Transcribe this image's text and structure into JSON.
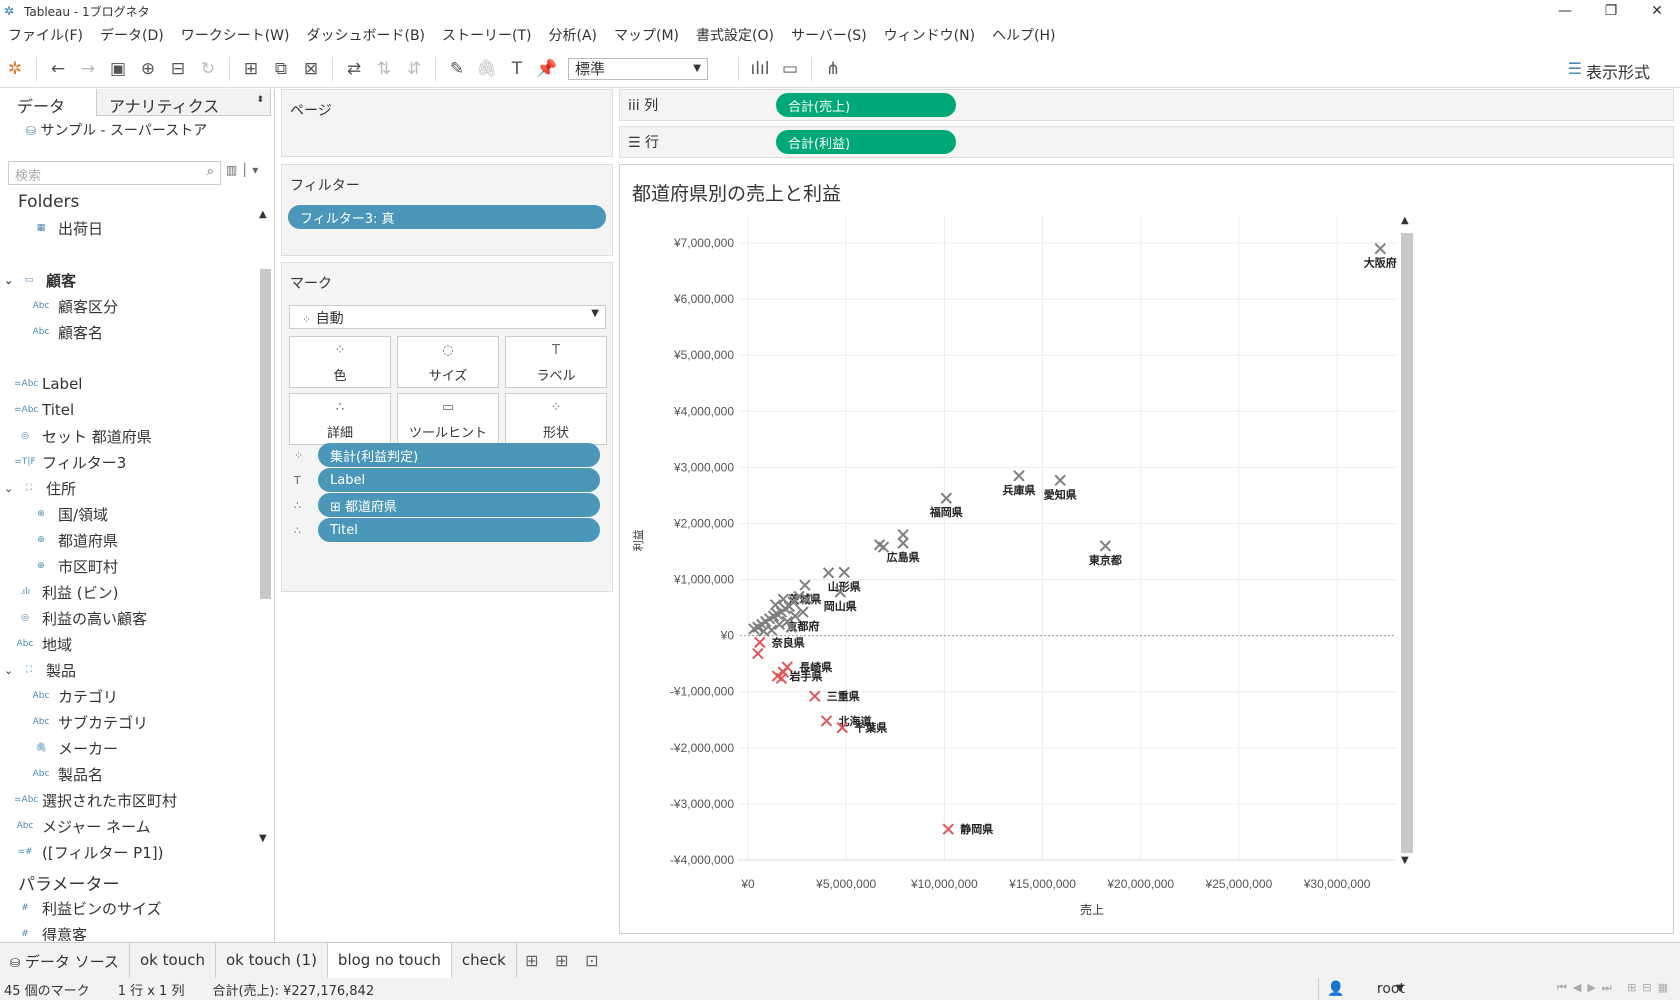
{
  "window": {
    "title": "Tableau - 1ブログネタ"
  },
  "menu": [
    "ファイル(F)",
    "データ(D)",
    "ワークシート(W)",
    "ダッシュボード(B)",
    "ストーリー(T)",
    "分析(A)",
    "マップ(M)",
    "書式設定(O)",
    "サーバー(S)",
    "ウィンドウ(N)",
    "ヘルプ(H)"
  ],
  "toolbar": {
    "fit": "標準",
    "show_me": "表示形式"
  },
  "data_pane": {
    "tab_data": "データ",
    "tab_analytics": "アナリティクス",
    "source": "サンプル - スーパーストア",
    "search_placeholder": "検索",
    "folders_label": "Folders",
    "fields": [
      {
        "icon": "calendar-icon",
        "label": "出荷日",
        "indent": 2,
        "glyph": "▦"
      },
      {
        "icon": "spacer",
        "label": "",
        "indent": 0,
        "glyph": ""
      },
      {
        "icon": "folder-icon",
        "label": "顧客",
        "indent": 1,
        "glyph": "▭",
        "hdr": true,
        "chev": "⌄"
      },
      {
        "icon": "abc-icon",
        "label": "顧客区分",
        "indent": 2,
        "glyph": "Abc"
      },
      {
        "icon": "abc-icon",
        "label": "顧客名",
        "indent": 2,
        "glyph": "Abc"
      },
      {
        "icon": "spacer",
        "label": "",
        "indent": 0,
        "glyph": ""
      },
      {
        "icon": "calc-abc-icon",
        "label": "Label",
        "indent": 1,
        "glyph": "=Abc"
      },
      {
        "icon": "calc-abc-icon",
        "label": "Titel",
        "indent": 1,
        "glyph": "=Abc"
      },
      {
        "icon": "set-icon",
        "label": "セット 都道府県",
        "indent": 1,
        "glyph": "◎"
      },
      {
        "icon": "calc-bool-icon",
        "label": "フィルター3",
        "indent": 1,
        "glyph": "=T|F"
      },
      {
        "icon": "hierarchy-icon",
        "label": "住所",
        "indent": 1,
        "glyph": "⛶",
        "chev": "⌄"
      },
      {
        "icon": "globe-icon",
        "label": "国/領域",
        "indent": 2,
        "glyph": "⊕"
      },
      {
        "icon": "globe-icon",
        "label": "都道府県",
        "indent": 2,
        "glyph": "⊕"
      },
      {
        "icon": "globe-icon",
        "label": "市区町村",
        "indent": 2,
        "glyph": "⊕"
      },
      {
        "icon": "bin-icon",
        "label": "利益 (ビン)",
        "indent": 1,
        "glyph": ".ılı"
      },
      {
        "icon": "set-icon",
        "label": "利益の高い顧客",
        "indent": 1,
        "glyph": "◎"
      },
      {
        "icon": "abc-icon",
        "label": "地域",
        "indent": 1,
        "glyph": "Abc"
      },
      {
        "icon": "hierarchy-icon",
        "label": "製品",
        "indent": 1,
        "glyph": "⛶",
        "chev": "⌄"
      },
      {
        "icon": "abc-icon",
        "label": "カテゴリ",
        "indent": 2,
        "glyph": "Abc"
      },
      {
        "icon": "abc-icon",
        "label": "サブカテゴリ",
        "indent": 2,
        "glyph": "Abc"
      },
      {
        "icon": "paperclip-icon",
        "label": "メーカー",
        "indent": 2,
        "glyph": "🖇"
      },
      {
        "icon": "abc-icon",
        "label": "製品名",
        "indent": 2,
        "glyph": "Abc"
      },
      {
        "icon": "calc-abc-icon",
        "label": "選択された市区町村",
        "indent": 1,
        "glyph": "=Abc"
      },
      {
        "icon": "abc-icon",
        "label": "メジャー ネーム",
        "indent": 1,
        "glyph": "Abc"
      },
      {
        "icon": "calc-number-icon",
        "label": "([フィルター P1])",
        "indent": 1,
        "glyph": "=#"
      }
    ],
    "parameters_label": "パラメーター",
    "parameters": [
      {
        "label": "利益ビンのサイズ",
        "glyph": "#"
      },
      {
        "label": "得意客",
        "glyph": "#"
      }
    ]
  },
  "shelves": {
    "pages": "ページ",
    "filters": "フィルター",
    "filter_pill": "フィルター3: 真",
    "marks": "マーク",
    "mark_type": "自動",
    "mark_buttons": [
      {
        "label": "色",
        "glyph": "⁘",
        "name": "color-button"
      },
      {
        "label": "サイズ",
        "glyph": "◌",
        "name": "size-button"
      },
      {
        "label": "ラベル",
        "glyph": "T",
        "name": "label-button"
      },
      {
        "label": "詳細",
        "glyph": "∴",
        "name": "detail-button"
      },
      {
        "label": "ツールヒント",
        "glyph": "▭",
        "name": "tooltip-button"
      },
      {
        "label": "形状",
        "glyph": "⁘",
        "name": "shape-button"
      }
    ],
    "mark_fields": [
      {
        "label": "集計(利益判定)",
        "glyph": "⁘"
      },
      {
        "label": "Label",
        "glyph": "T"
      },
      {
        "label": "⊞ 都道府県",
        "glyph": "∴"
      },
      {
        "label": "Titel",
        "glyph": "∴"
      }
    ],
    "columns_label": "iii 列",
    "columns_pill": "合計(売上)",
    "rows_label": "☰ 行",
    "rows_pill": "合計(利益)"
  },
  "chart_title": "都道府県別の売上と利益",
  "chart_data": {
    "type": "scatter",
    "title": "都道府県別の売上と利益",
    "xlabel": "売上",
    "ylabel": "利益",
    "xlim": [
      0,
      33000000
    ],
    "ylim": [
      -4000000,
      7500000
    ],
    "xticks": [
      0,
      5000000,
      10000000,
      15000000,
      20000000,
      25000000,
      30000000
    ],
    "xtick_labels": [
      "¥0",
      "¥5,000,000",
      "¥10,000,000",
      "¥15,000,000",
      "¥20,000,000",
      "¥25,000,000",
      "¥30,000,000"
    ],
    "yticks": [
      7000000,
      6000000,
      5000000,
      4000000,
      3000000,
      2000000,
      1000000,
      0,
      -1000000,
      -2000000,
      -3000000,
      -4000000
    ],
    "ytick_labels": [
      "¥7,000,000",
      "¥6,000,000",
      "¥5,000,000",
      "¥4,000,000",
      "¥3,000,000",
      "¥2,000,000",
      "¥1,000,000",
      "¥0",
      "-¥1,000,000",
      "-¥2,000,000",
      "-¥3,000,000",
      "-¥4,000,000"
    ],
    "colors": {
      "positive": "#7f7f7f",
      "negative": "#e15759"
    },
    "points": [
      {
        "label": "大阪府",
        "x": 32200000,
        "y": 6900000,
        "neg": false
      },
      {
        "label": "兵庫県",
        "x": 13800000,
        "y": 2850000,
        "neg": false
      },
      {
        "label": "愛知県",
        "x": 15900000,
        "y": 2770000,
        "neg": false
      },
      {
        "label": "福岡県",
        "x": 10100000,
        "y": 2450000,
        "neg": false
      },
      {
        "label": "東京都",
        "x": 18200000,
        "y": 1600000,
        "neg": false
      },
      {
        "label": "広島県",
        "x": 7900000,
        "y": 1650000,
        "neg": false
      },
      {
        "label": "",
        "x": 7900000,
        "y": 1800000,
        "neg": false
      },
      {
        "label": "",
        "x": 6700000,
        "y": 1620000,
        "neg": false
      },
      {
        "label": "",
        "x": 6900000,
        "y": 1580000,
        "neg": false
      },
      {
        "label": "山形県",
        "x": 4900000,
        "y": 1130000,
        "neg": false
      },
      {
        "label": "",
        "x": 4100000,
        "y": 1120000,
        "neg": false
      },
      {
        "label": "茨城県",
        "x": 2900000,
        "y": 900000,
        "neg": false
      },
      {
        "label": "岡山県",
        "x": 4700000,
        "y": 780000,
        "neg": false
      },
      {
        "label": "京都府",
        "x": 2800000,
        "y": 420000,
        "neg": false
      },
      {
        "label": "",
        "x": 3000000,
        "y": 650000,
        "neg": false
      },
      {
        "label": "",
        "x": 2600000,
        "y": 700000,
        "neg": false
      },
      {
        "label": "",
        "x": 2300000,
        "y": 600000,
        "neg": false
      },
      {
        "label": "",
        "x": 2100000,
        "y": 520000,
        "neg": false
      },
      {
        "label": "",
        "x": 1900000,
        "y": 480000,
        "neg": false
      },
      {
        "label": "",
        "x": 1700000,
        "y": 420000,
        "neg": false
      },
      {
        "label": "",
        "x": 1500000,
        "y": 380000,
        "neg": false
      },
      {
        "label": "",
        "x": 1300000,
        "y": 350000,
        "neg": false
      },
      {
        "label": "",
        "x": 1100000,
        "y": 300000,
        "neg": false
      },
      {
        "label": "",
        "x": 900000,
        "y": 250000,
        "neg": false
      },
      {
        "label": "",
        "x": 700000,
        "y": 200000,
        "neg": false
      },
      {
        "label": "",
        "x": 500000,
        "y": 150000,
        "neg": false
      },
      {
        "label": "",
        "x": 300000,
        "y": 120000,
        "neg": false
      },
      {
        "label": "",
        "x": 1600000,
        "y": 200000,
        "neg": false
      },
      {
        "label": "",
        "x": 2000000,
        "y": 250000,
        "neg": false
      },
      {
        "label": "",
        "x": 1200000,
        "y": 100000,
        "neg": false
      },
      {
        "label": "",
        "x": 800000,
        "y": 80000,
        "neg": false
      },
      {
        "label": "",
        "x": 2400000,
        "y": 350000,
        "neg": false
      },
      {
        "label": "",
        "x": 1400000,
        "y": 550000,
        "neg": false
      },
      {
        "label": "",
        "x": 1800000,
        "y": 650000,
        "neg": false
      },
      {
        "label": "奈良県",
        "x": 600000,
        "y": -120000,
        "neg": true
      },
      {
        "label": "",
        "x": 500000,
        "y": -320000,
        "neg": true
      },
      {
        "label": "長崎県",
        "x": 2000000,
        "y": -560000,
        "neg": true
      },
      {
        "label": "",
        "x": 1800000,
        "y": -650000,
        "neg": true
      },
      {
        "label": "岩手県",
        "x": 1500000,
        "y": -720000,
        "neg": true
      },
      {
        "label": "",
        "x": 1700000,
        "y": -760000,
        "neg": true
      },
      {
        "label": "三重県",
        "x": 3400000,
        "y": -1080000,
        "neg": true
      },
      {
        "label": "北海道",
        "x": 4000000,
        "y": -1520000,
        "neg": true
      },
      {
        "label": "千葉県",
        "x": 4800000,
        "y": -1640000,
        "neg": true
      },
      {
        "label": "静岡県",
        "x": 10200000,
        "y": -3450000,
        "neg": true
      },
      {
        "label": "",
        "x": 2200000,
        "y": 150000,
        "neg": false
      }
    ]
  },
  "sheet_tabs": {
    "datasource": "データ ソース",
    "sheets": [
      "ok touch",
      "ok touch (1)",
      "blog no touch",
      "check"
    ],
    "active": "blog no touch"
  },
  "status": {
    "marks": "45 個のマーク",
    "rows_cols": "1 行 x 1 列",
    "sum": "合計(売上): ¥227,176,842",
    "user": "root"
  }
}
